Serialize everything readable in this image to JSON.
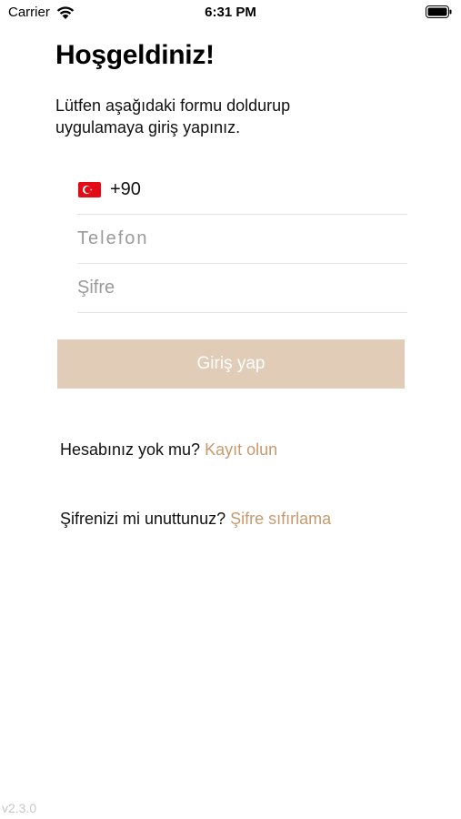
{
  "status_bar": {
    "carrier": "Carrier",
    "time": "6:31 PM"
  },
  "heading": {
    "title": "Hoşgeldiniz!",
    "subtitle": "Lütfen aşağıdaki formu doldurup uygulamaya giriş yapınız."
  },
  "form": {
    "country": {
      "flag_icon": "turkey-flag-icon",
      "code": "+90"
    },
    "phone": {
      "placeholder": "Telefon",
      "value": ""
    },
    "password": {
      "placeholder": "Şifre",
      "value": ""
    },
    "submit_label": "Giriş yap"
  },
  "register": {
    "prompt": "Hesabınız yok mu?",
    "link_label": "Kayıt olun"
  },
  "reset": {
    "prompt": "Şifrenizi mi unuttunuz?",
    "link_label": "Şifre sıfırlama"
  },
  "version": "v2.3.0",
  "colors": {
    "accent": "#c69a6d",
    "button_bg": "#e0ccb7",
    "divider": "#e3e3e3",
    "placeholder": "#9a9a9a",
    "flag_red": "#e30a17"
  }
}
